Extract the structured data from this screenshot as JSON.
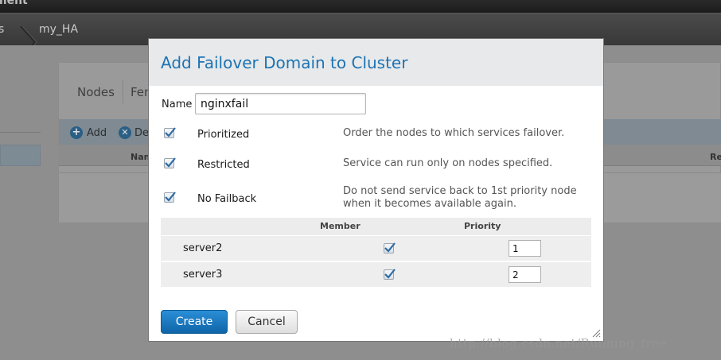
{
  "app": {
    "title_fragment": "ment"
  },
  "breadcrumb": {
    "prev": "s",
    "current": "my_HA"
  },
  "background_panel": {
    "tabs": [
      "Nodes",
      "Fen"
    ],
    "toolbar": {
      "add_label": "Add",
      "delete_label": "De"
    },
    "columns": {
      "name": "Nan",
      "right": "Re"
    }
  },
  "dialog": {
    "title": "Add Failover Domain to Cluster",
    "name_label": "Name",
    "name_value": "nginxfail",
    "options": [
      {
        "label": "Prioritized",
        "checked": true,
        "description": "Order the nodes to which services failover."
      },
      {
        "label": "Restricted",
        "checked": true,
        "description": "Service can run only on nodes specified."
      },
      {
        "label": "No Failback",
        "checked": true,
        "description_line1": "Do not send service back to 1st priority node",
        "description_line2": "when it becomes available again."
      }
    ],
    "table": {
      "col_member": "Member",
      "col_priority": "Priority",
      "rows": [
        {
          "server": "server2",
          "member": true,
          "priority": "1"
        },
        {
          "server": "server3",
          "member": true,
          "priority": "2"
        }
      ]
    },
    "create_label": "Create",
    "cancel_label": "Cancel"
  },
  "watermark": "http://blog.csdn.net/Running_free",
  "colors": {
    "accent": "#1c73b4",
    "create_button": "#1a78c2"
  }
}
